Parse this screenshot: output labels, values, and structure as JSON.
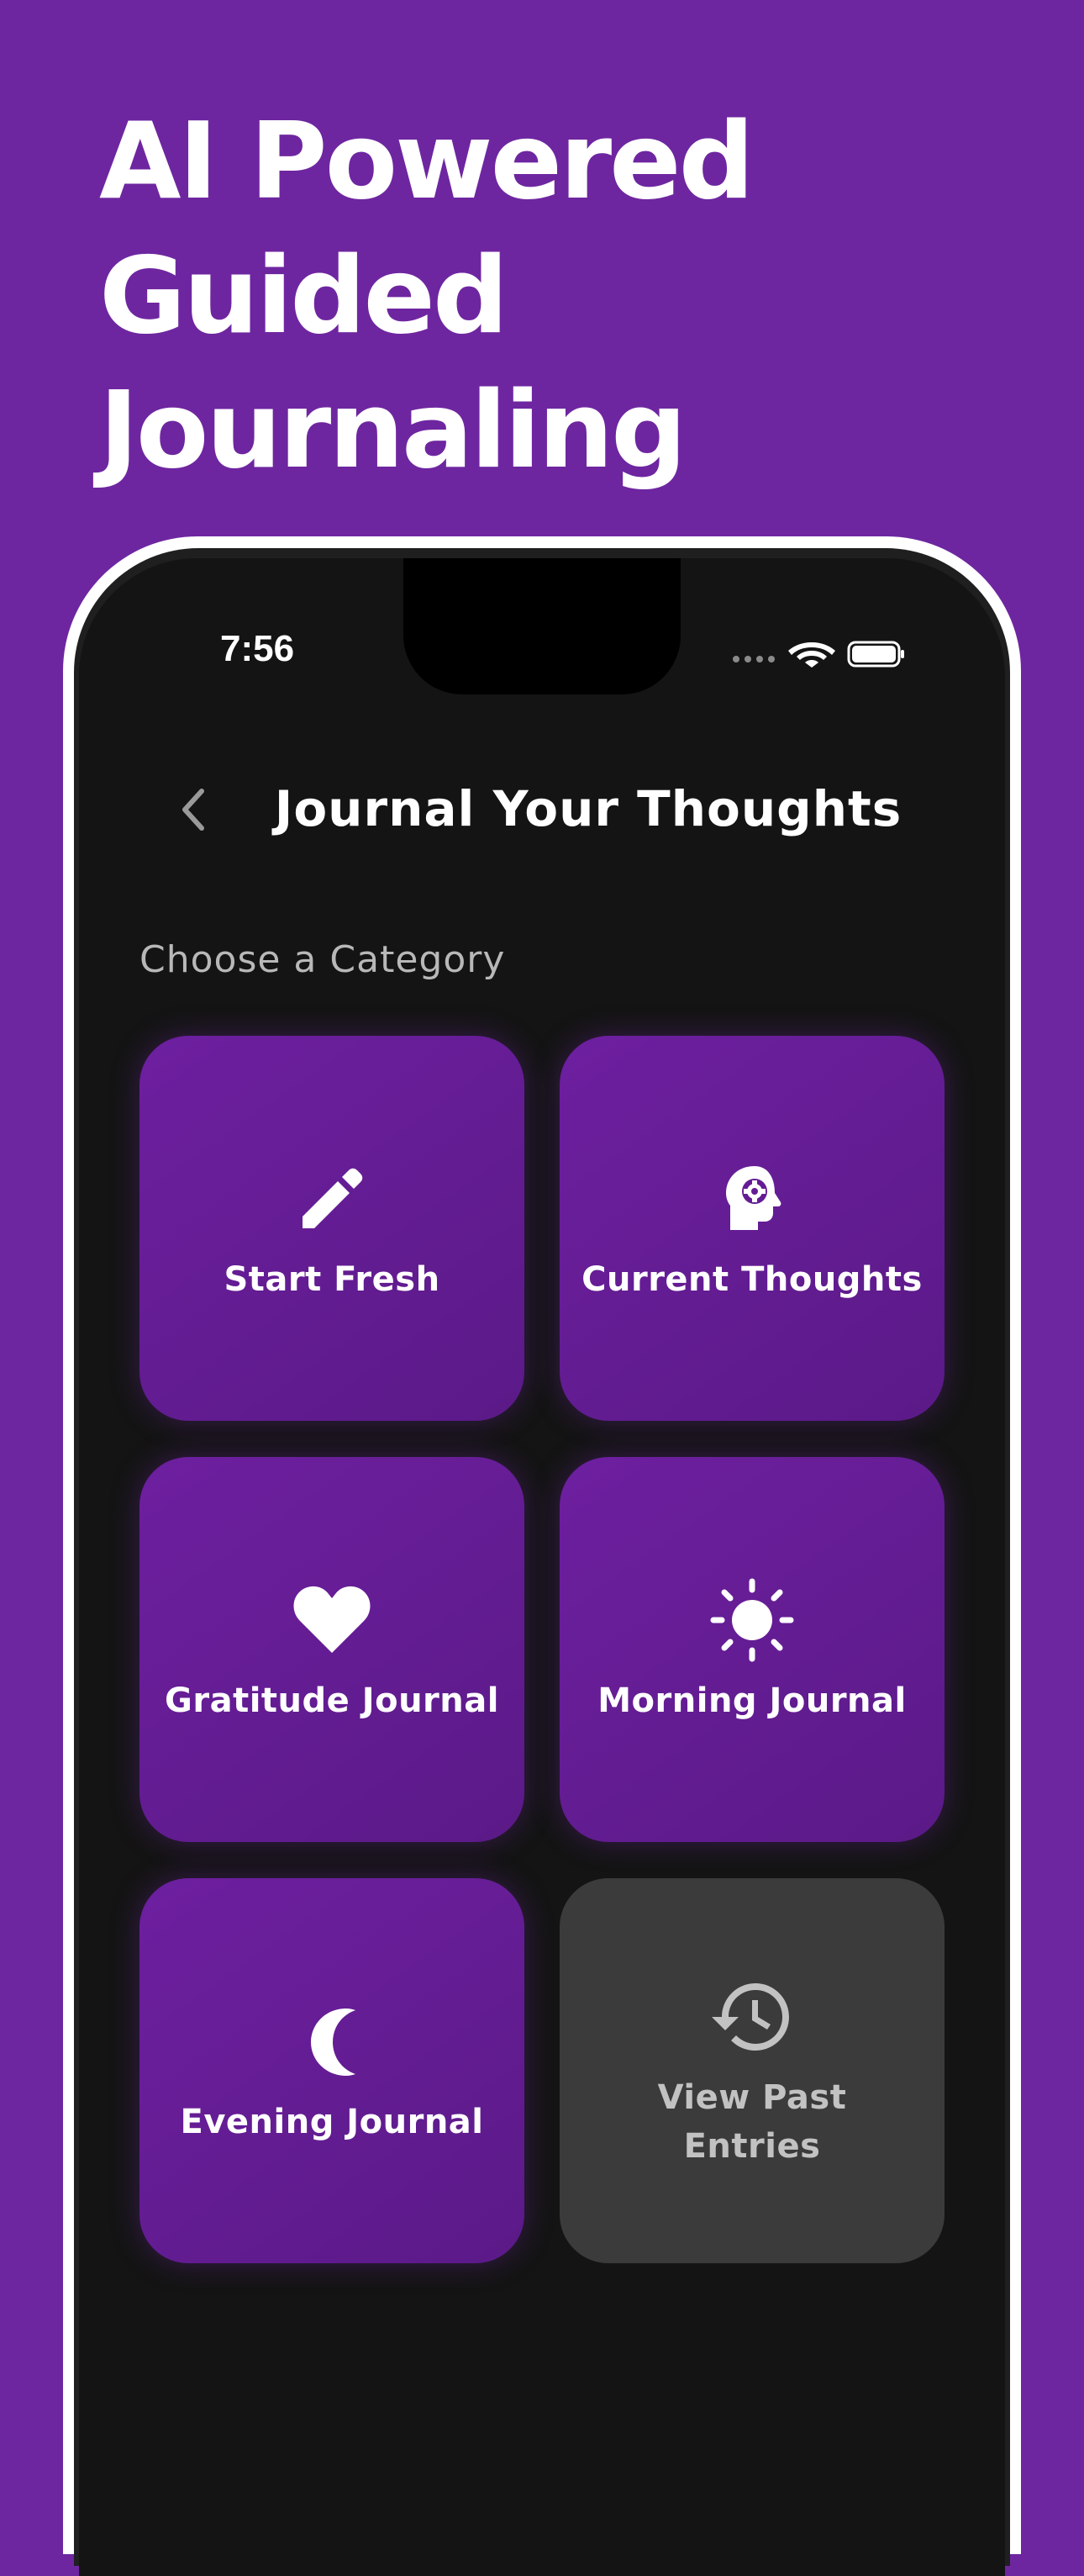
{
  "promo": {
    "headline_lines": [
      "AI Powered",
      "Guided",
      "Journaling"
    ]
  },
  "status_bar": {
    "time": "7:56",
    "icons": [
      "signal-dots-icon",
      "wifi-icon",
      "battery-icon"
    ]
  },
  "nav": {
    "back_icon": "chevron-left-icon",
    "title": "Journal Your Thoughts"
  },
  "main": {
    "section_label": "Choose a Category",
    "categories": [
      {
        "label": "Start Fresh",
        "icon": "pencil-icon",
        "style": "accent"
      },
      {
        "label": "Current Thoughts",
        "icon": "head-gear-icon",
        "style": "accent"
      },
      {
        "label": "Gratitude Journal",
        "icon": "heart-icon",
        "style": "accent"
      },
      {
        "label": "Morning Journal",
        "icon": "sun-icon",
        "style": "accent"
      },
      {
        "label": "Evening Journal",
        "icon": "moon-icon",
        "style": "accent"
      },
      {
        "label": "View Past Entries",
        "icon": "history-icon",
        "style": "muted"
      }
    ]
  },
  "colors": {
    "background": "#6e26a0",
    "screen": "#141414",
    "tile_accent": "#6a1e9c",
    "tile_muted": "#3b3b3b",
    "text_primary": "#ffffff",
    "text_secondary": "#b8b8b8"
  }
}
